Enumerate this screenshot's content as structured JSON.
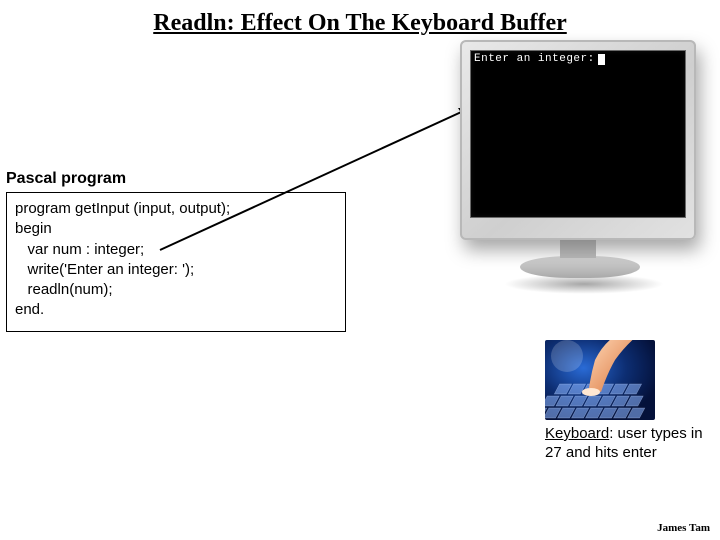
{
  "title": "Readln: Effect On The Keyboard Buffer",
  "section_label": "Pascal program",
  "code": "program getInput (input, output);\nbegin\n   var num : integer;\n   write('Enter an integer: ');\n   readln(num);\nend.",
  "terminal_prompt": "Enter an integer:",
  "keyboard_caption_keyword": "Keyboard",
  "keyboard_caption_rest": ": user types in 27 and hits enter",
  "footer": "James Tam"
}
